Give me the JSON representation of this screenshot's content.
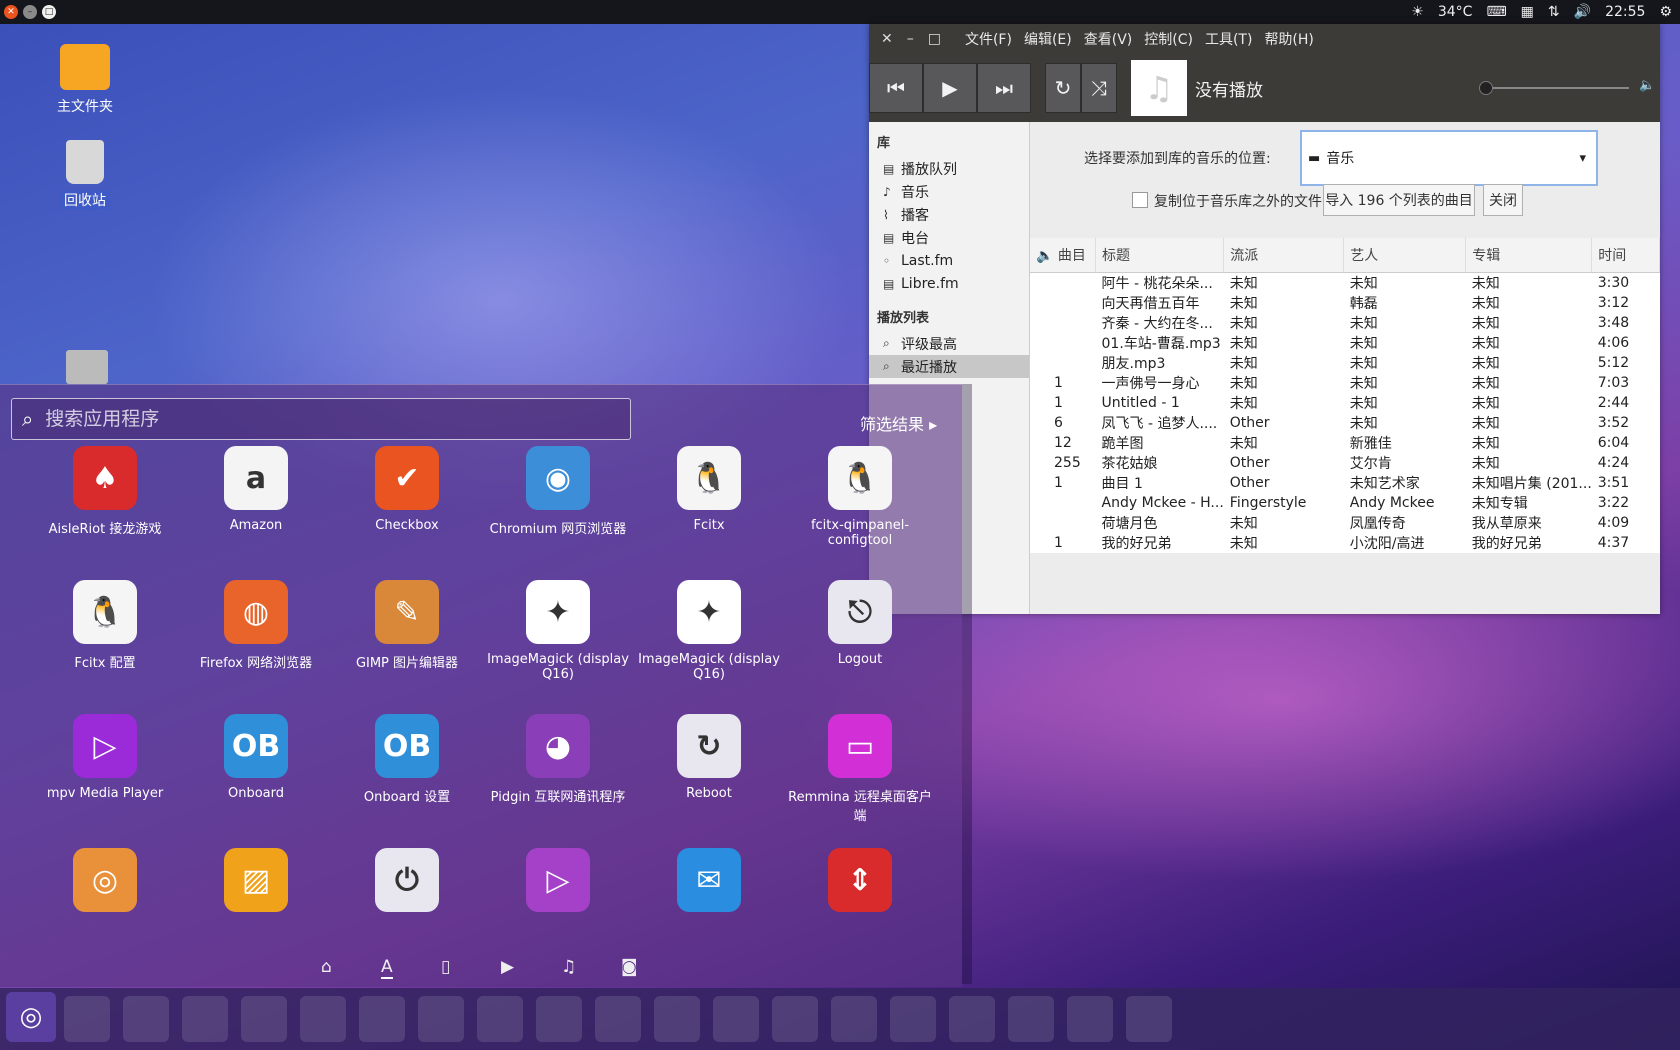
{
  "topbar": {
    "temp": "34°C",
    "time": "22:55"
  },
  "desktop": {
    "home_label": "主文件夹",
    "trash_label": "回收站"
  },
  "player": {
    "menu": [
      "文件(F)",
      "编辑(E)",
      "查看(V)",
      "控制(C)",
      "工具(T)",
      "帮助(H)"
    ],
    "now_playing": "没有播放",
    "library_header": "库",
    "library_items": [
      "播放队列",
      "音乐",
      "播客",
      "电台",
      "Last.fm",
      "Libre.fm"
    ],
    "playlist_header": "播放列表",
    "playlist_items": [
      "评级最高",
      "最近播放"
    ],
    "location_label": "选择要添加到库的音乐的位置:",
    "location_value": "音乐",
    "copy_label": "复制位于音乐库之外的文件",
    "import_button": "导入 196 个列表的曲目",
    "close_button": "关闭",
    "columns": [
      "曲目",
      "标题",
      "流派",
      "艺人",
      "专辑",
      "时间"
    ],
    "tracks": [
      {
        "no": "",
        "title": "阿牛 - 桃花朵朵...",
        "genre": "未知",
        "artist": "未知",
        "album": "未知",
        "time": "3:30"
      },
      {
        "no": "",
        "title": "向天再借五百年",
        "genre": "未知",
        "artist": "韩磊",
        "album": "未知",
        "time": "3:12"
      },
      {
        "no": "",
        "title": "齐秦 - 大约在冬...",
        "genre": "未知",
        "artist": "未知",
        "album": "未知",
        "time": "3:48"
      },
      {
        "no": "",
        "title": "01.车站-曹磊.mp3",
        "genre": "未知",
        "artist": "未知",
        "album": "未知",
        "time": "4:06"
      },
      {
        "no": "",
        "title": "朋友.mp3",
        "genre": "未知",
        "artist": "未知",
        "album": "未知",
        "time": "5:12"
      },
      {
        "no": "1",
        "title": "一声佛号一身心",
        "genre": "未知",
        "artist": "未知",
        "album": "未知",
        "time": "7:03"
      },
      {
        "no": "1",
        "title": "Untitled - 1",
        "genre": "未知",
        "artist": "未知",
        "album": "未知",
        "time": "2:44"
      },
      {
        "no": "6",
        "title": "凤飞飞 - 追梦人....",
        "genre": "Other",
        "artist": "未知",
        "album": "未知",
        "time": "3:52"
      },
      {
        "no": "12",
        "title": "跪羊图",
        "genre": "未知",
        "artist": "新雅佳",
        "album": "未知",
        "time": "6:04"
      },
      {
        "no": "255",
        "title": "茶花姑娘",
        "genre": "Other",
        "artist": "艾尔肯",
        "album": "未知",
        "time": "4:24"
      },
      {
        "no": "1",
        "title": "曲目 1",
        "genre": "Other",
        "artist": "未知艺术家",
        "album": "未知唱片集 (201...",
        "time": "3:51"
      },
      {
        "no": "",
        "title": "Andy Mckee - H...",
        "genre": "Fingerstyle",
        "artist": "Andy Mckee",
        "album": "未知专辑",
        "time": "3:22"
      },
      {
        "no": "",
        "title": "荷塘月色",
        "genre": "未知",
        "artist": "凤凰传奇",
        "album": "我从草原来",
        "time": "4:09"
      },
      {
        "no": "1",
        "title": "我的好兄弟",
        "genre": "未知",
        "artist": "小沈阳/高进",
        "album": "我的好兄弟",
        "time": "4:37"
      }
    ]
  },
  "dash": {
    "search_placeholder": "搜索应用程序",
    "filter_label": "筛选结果",
    "apps": [
      {
        "name": "AisleRiot 接龙游戏",
        "color": "#d92b2b",
        "glyph": "♠"
      },
      {
        "name": "Amazon",
        "color": "#f4f4f4",
        "glyph": "a"
      },
      {
        "name": "Checkbox",
        "color": "#e95420",
        "glyph": "✔"
      },
      {
        "name": "Chromium 网页浏览器",
        "color": "#3c8ed9",
        "glyph": "◉"
      },
      {
        "name": "Fcitx",
        "color": "#f5f5f5",
        "glyph": "🐧"
      },
      {
        "name": "fcitx-qimpanel-configtool",
        "color": "#f5f5f5",
        "glyph": "🐧"
      },
      {
        "name": "Fcitx 配置",
        "color": "#f5f5f5",
        "glyph": "🐧"
      },
      {
        "name": "Firefox 网络浏览器",
        "color": "#e8642b",
        "glyph": "◍"
      },
      {
        "name": "GIMP 图片编辑器",
        "color": "#d9883a",
        "glyph": "✎"
      },
      {
        "name": "ImageMagick (display Q16)",
        "color": "#ffffff",
        "glyph": "✦"
      },
      {
        "name": "ImageMagick (display Q16)",
        "color": "#ffffff",
        "glyph": "✦"
      },
      {
        "name": "Logout",
        "color": "#e8e6ef",
        "glyph": "⎋"
      },
      {
        "name": "mpv Media Player",
        "color": "#9b2ad8",
        "glyph": "▷"
      },
      {
        "name": "Onboard",
        "color": "#2f8fd9",
        "glyph": "OB"
      },
      {
        "name": "Onboard 设置",
        "color": "#2f8fd9",
        "glyph": "OB"
      },
      {
        "name": "Pidgin 互联网通讯程序",
        "color": "#8a3fb8",
        "glyph": "◕"
      },
      {
        "name": "Reboot",
        "color": "#e8e6ef",
        "glyph": "↻"
      },
      {
        "name": "Remmina 远程桌面客户端",
        "color": "#d22fd6",
        "glyph": "▭"
      },
      {
        "name": "",
        "color": "#e8913a",
        "glyph": "◎"
      },
      {
        "name": "",
        "color": "#f0a21a",
        "glyph": "▨"
      },
      {
        "name": "",
        "color": "#e8e6ef",
        "glyph": "⏻"
      },
      {
        "name": "",
        "color": "#a540c9",
        "glyph": "▷"
      },
      {
        "name": "",
        "color": "#2a8de0",
        "glyph": "✉"
      },
      {
        "name": "",
        "color": "#d92b2b",
        "glyph": "⇕"
      }
    ]
  }
}
